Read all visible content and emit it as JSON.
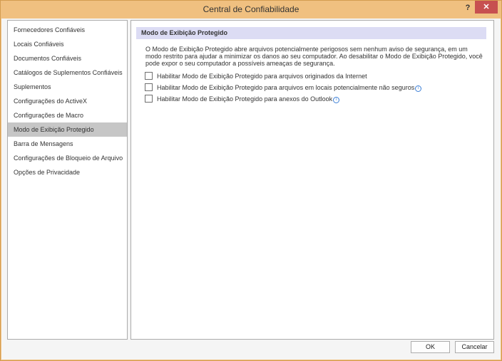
{
  "window": {
    "title": "Central de Confiabilidade",
    "help_glyph": "?",
    "close_glyph": "✕"
  },
  "sidebar": {
    "items": [
      {
        "label": "Fornecedores Confiáveis"
      },
      {
        "label": "Locais Confiáveis"
      },
      {
        "label": "Documentos Confiáveis"
      },
      {
        "label": "Catálogos de Suplementos Confiáveis"
      },
      {
        "label": "Suplementos"
      },
      {
        "label": "Configurações do ActiveX"
      },
      {
        "label": "Configurações de Macro"
      },
      {
        "label": "Modo de Exibição Protegido"
      },
      {
        "label": "Barra de Mensagens"
      },
      {
        "label": "Configurações de Bloqueio de Arquivo"
      },
      {
        "label": "Opções de Privacidade"
      }
    ],
    "selected_index": 7
  },
  "content": {
    "section_title": "Modo de Exibição Protegido",
    "description": "O Modo de Exibição Protegido abre arquivos potencialmente perigosos sem nenhum aviso de segurança, em um modo restrito para ajudar a minimizar os danos ao seu computador. Ao desabilitar o Modo de Exibição Protegido, você pode expor o seu computador a possíveis ameaças de segurança.",
    "options": [
      {
        "label": "Habilitar Modo de Exibição Protegido para arquivos originados da Internet",
        "checked": false,
        "info": false
      },
      {
        "label": "Habilitar Modo de Exibição Protegido para arquivos em locais potencialmente não seguros",
        "checked": false,
        "info": true
      },
      {
        "label": "Habilitar Modo de Exibição Protegido para anexos do Outlook",
        "checked": false,
        "info": true
      }
    ],
    "info_glyph": "i"
  },
  "buttons": {
    "ok": "OK",
    "cancel": "Cancelar"
  }
}
